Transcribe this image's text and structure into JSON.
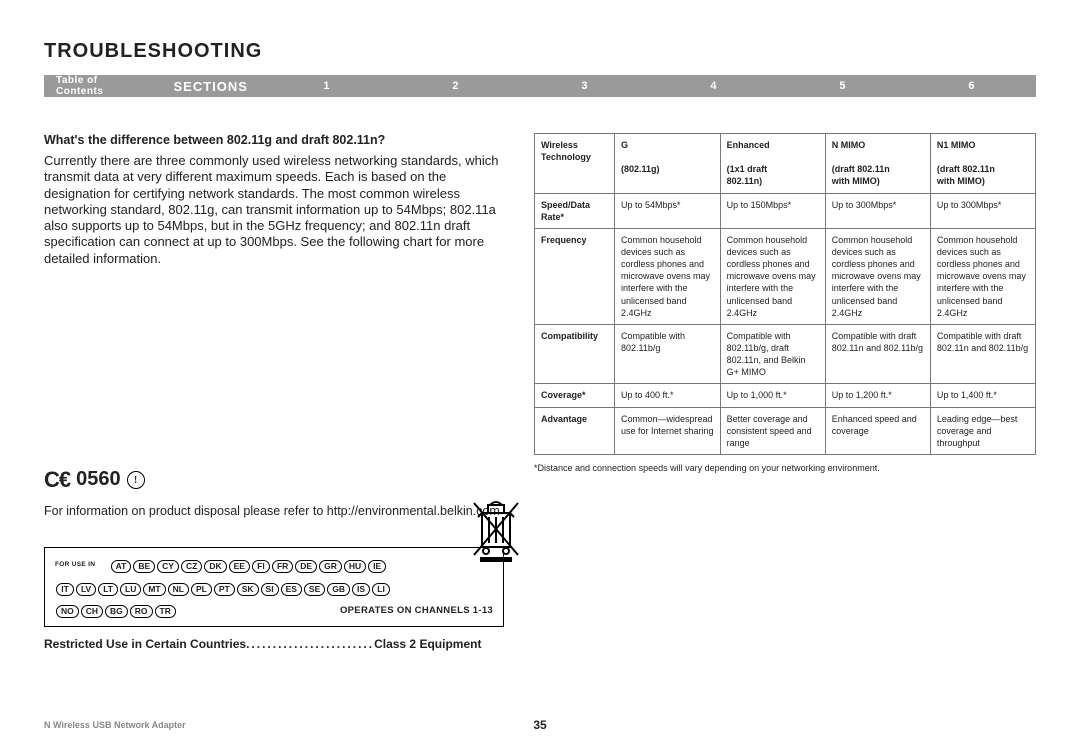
{
  "title": "TROUBLESHOOTING",
  "nav": {
    "toc": "Table of Contents",
    "sections": "SECTIONS",
    "n1": "1",
    "n2": "2",
    "n3": "3",
    "n4": "4",
    "n5": "5",
    "n6": "6"
  },
  "left": {
    "question": "What's the difference between 802.11g and draft 802.11n?",
    "para": "Currently there are three commonly used wireless networking standards, which transmit data at very different maximum speeds. Each is based on the designation for certifying network standards. The most common wireless networking standard, 802.11g, can transmit information up to 54Mbps; 802.11a also supports up to 54Mbps, but in the 5GHz frequency; and 802.11n draft specification can connect at up to 300Mbps. See the following chart for more detailed information.",
    "ce_mark": "C€",
    "ce_code": "0560",
    "ce_exc": "!",
    "disposal": "For information on product disposal please refer to http://environmental.belkin.com",
    "for_use": "FOR USE IN",
    "countries_r1": [
      "AT",
      "BE",
      "CY",
      "CZ",
      "DK",
      "EE",
      "FI",
      "FR",
      "DE",
      "GR",
      "HU",
      "IE"
    ],
    "countries_r2": [
      "IT",
      "LV",
      "LT",
      "LU",
      "MT",
      "NL",
      "PL",
      "PT",
      "SK",
      "SI",
      "ES",
      "SE",
      "GB",
      "IS",
      "LI"
    ],
    "countries_r3": [
      "NO",
      "CH",
      "BG",
      "RO",
      "TR"
    ],
    "operates": "OPERATES ON CHANNELS 1-13",
    "restricted_a": "Restricted Use in Certain Countries",
    "restricted_b": "Class 2 Equipment"
  },
  "table": {
    "h_tech_a": "Wireless",
    "h_tech_b": "Technology",
    "h_g_a": "G",
    "h_g_b": "(802.11g)",
    "h_e_a": "Enhanced",
    "h_e_b": "(1x1 draft",
    "h_e_c": "802.11n)",
    "h_nm_a": "N MIMO",
    "h_nm_b": "(draft 802.11n",
    "h_nm_c": "with MIMO)",
    "h_n1_a": "N1 MIMO",
    "h_n1_b": "(draft 802.11n",
    "h_n1_c": "with MIMO)",
    "r_speed_a": "Speed/Data",
    "r_speed_b": "Rate*",
    "c_speed_g": "Up to 54Mbps*",
    "c_speed_e": "Up to 150Mbps*",
    "c_speed_nm": "Up to 300Mbps*",
    "c_speed_n1": "Up to 300Mbps*",
    "r_freq": "Frequency",
    "c_freq": "Common household devices such as cordless phones and microwave ovens may interfere with the unlicensed band 2.4GHz",
    "r_compat": "Compatibility",
    "c_compat_g": "Compatible with 802.11b/g",
    "c_compat_e": "Compatible with 802.11b/g, draft 802.11n, and Belkin G+ MIMO",
    "c_compat_nm": "Compatible with draft 802.11n and 802.11b/g",
    "c_compat_n1": "Compatible with draft 802.11n and 802.11b/g",
    "r_cov": "Coverage*",
    "c_cov_g": "Up to 400 ft.*",
    "c_cov_e": "Up to 1,000 ft.*",
    "c_cov_nm": "Up to 1,200 ft.*",
    "c_cov_n1": "Up to 1,400 ft.*",
    "r_adv": "Advantage",
    "c_adv_g": "Common—widespread use for Internet sharing",
    "c_adv_e": "Better coverage and consistent speed and range",
    "c_adv_nm": "Enhanced speed and coverage",
    "c_adv_n1": "Leading edge—best coverage and throughput",
    "footnote": "*Distance and connection speeds will vary depending on your networking environment."
  },
  "footer": {
    "product": "N Wireless USB Network Adapter",
    "page": "35"
  }
}
